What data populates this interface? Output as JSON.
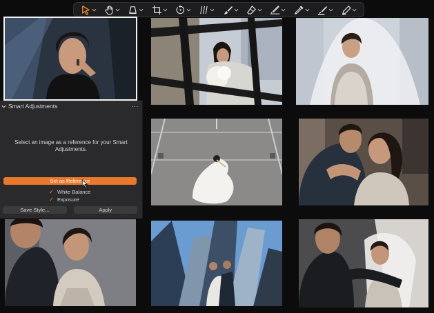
{
  "toolbar": {
    "tools": [
      {
        "icon": "cursor-icon",
        "active": true
      },
      {
        "icon": "hand-icon"
      },
      {
        "icon": "keystone-icon"
      },
      {
        "icon": "crop-icon"
      },
      {
        "icon": "rotate-icon"
      },
      {
        "icon": "straighten-icon"
      },
      {
        "icon": "brush-icon"
      },
      {
        "icon": "eraser-icon"
      },
      {
        "icon": "gradient-icon"
      },
      {
        "icon": "picker-icon"
      },
      {
        "icon": "heal-icon"
      },
      {
        "icon": "clone-icon"
      }
    ],
    "accent": "#f28b2f"
  },
  "panel": {
    "title": "Smart Adjustments",
    "more": "···",
    "instruction": "Select an image as a reference for your Smart Adjustments.",
    "set_reference": "Set as Reference",
    "options": [
      {
        "label": "White Balance",
        "checked": true
      },
      {
        "label": "Exposure",
        "checked": true
      }
    ],
    "save_style": "Save Style...",
    "apply": "Apply",
    "accent": "#e8782c"
  },
  "thumbnails": [
    {
      "name": "photo-woman-lipstick",
      "selected": true
    },
    {
      "name": "photo-bride-flowers-railing"
    },
    {
      "name": "photo-bride-veil-laughing"
    },
    {
      "name": "photo-bride-lying-gown"
    },
    {
      "name": "photo-couple-embrace"
    },
    {
      "name": "photo-couple-close"
    },
    {
      "name": "photo-couple-skyscrapers"
    },
    {
      "name": "photo-groom-bride-veil"
    }
  ]
}
